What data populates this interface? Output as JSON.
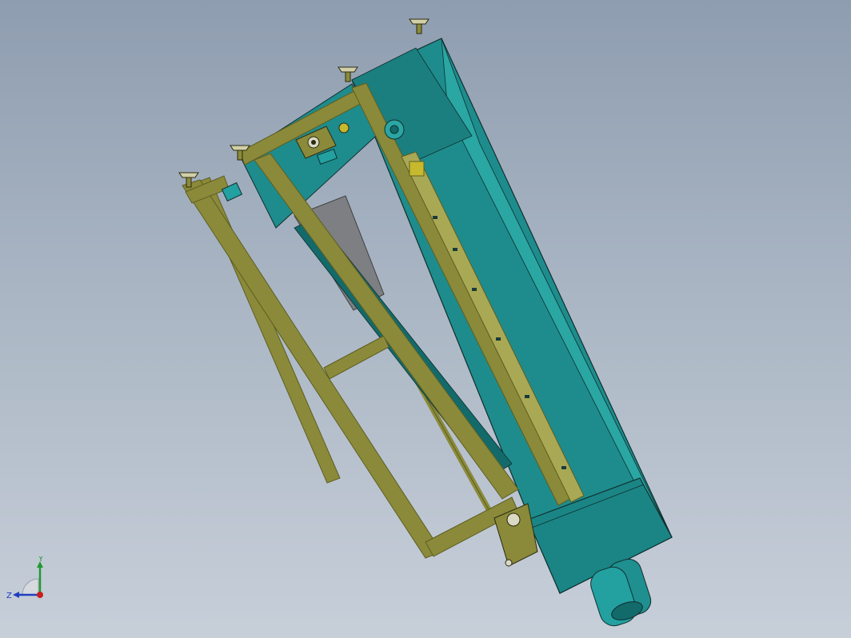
{
  "viewport": {
    "background_top": "#8e9db0",
    "background_bottom": "#c7cfd9"
  },
  "model": {
    "colors": {
      "housing_teal": "#1e8c8c",
      "housing_teal_dark": "#136a6a",
      "housing_teal_light": "#2aa6a3",
      "frame_olive": "#8a8a3a",
      "frame_olive_dark": "#5e5e22",
      "frame_olive_light": "#a9a955",
      "plate_gray": "#7d7f82",
      "edge": "#0f2f2f"
    }
  },
  "triad": {
    "x_label": "",
    "y_label": "Y",
    "z_label": "Z",
    "colors": {
      "x": "#c81e1e",
      "y": "#1f9a2f",
      "z": "#1f3fbf"
    }
  }
}
